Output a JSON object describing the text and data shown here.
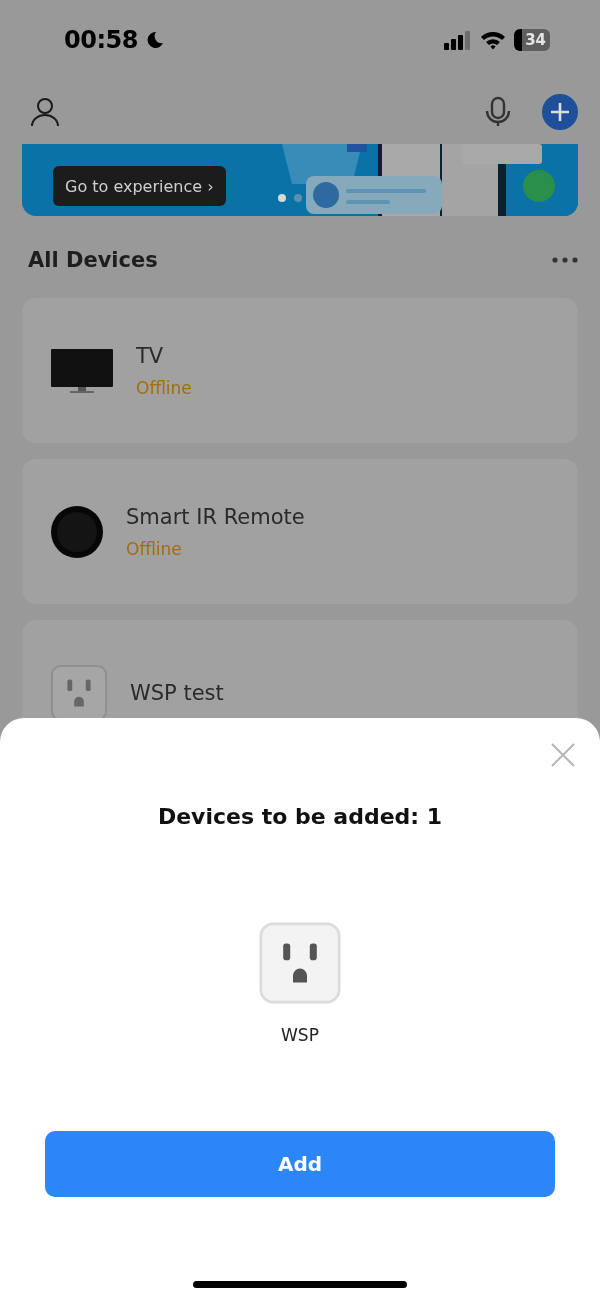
{
  "status_bar": {
    "time": "00:58",
    "battery": "34"
  },
  "banner": {
    "button": "Go to experience ›",
    "dots": [
      {
        "selected": true
      },
      {
        "selected": false
      }
    ]
  },
  "section": {
    "title": "All Devices"
  },
  "devices": [
    {
      "name": "TV",
      "status": "Offline",
      "kind": "tv"
    },
    {
      "name": "Smart IR Remote",
      "status": "Offline",
      "kind": "remote"
    },
    {
      "name": "WSP test",
      "kind": "plug"
    }
  ],
  "sheet": {
    "title": "Devices to be added: 1",
    "devices": [
      {
        "name": "WSP",
        "kind": "plug"
      }
    ],
    "button": "Add"
  }
}
